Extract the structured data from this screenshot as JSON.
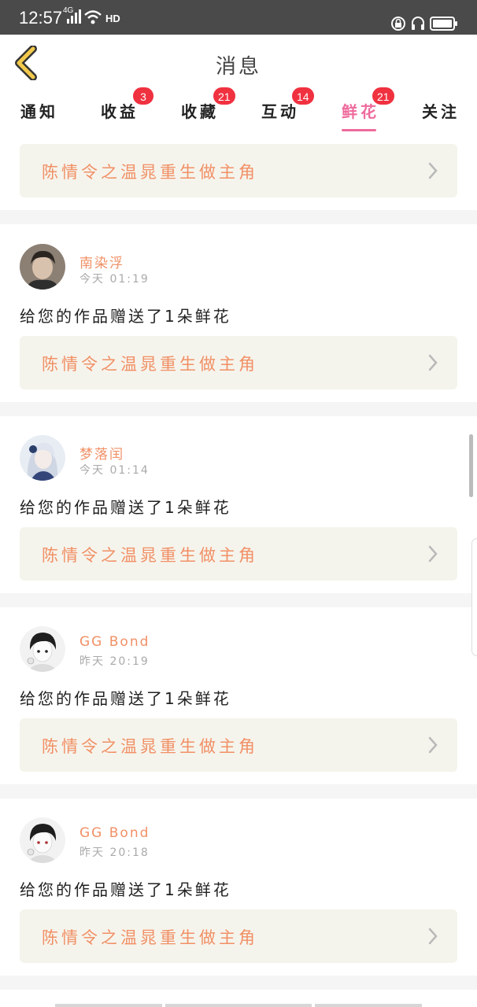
{
  "status_bar": {
    "time": "12:57",
    "network": "4G",
    "hd": "HD"
  },
  "header": {
    "title": "消息",
    "back_icon": "chevron-left-icon"
  },
  "tabs": [
    {
      "label": "通知",
      "badge": ""
    },
    {
      "label": "收益",
      "badge": "3"
    },
    {
      "label": "收藏",
      "badge": "21"
    },
    {
      "label": "互动",
      "badge": "14"
    },
    {
      "label": "鲜花",
      "badge": "21"
    },
    {
      "label": "关注",
      "badge": ""
    }
  ],
  "active_tab": "鲜花",
  "top_book": "陈情令之温晁重生做主角",
  "messages": [
    {
      "user": "南染浮",
      "time": "今天 01:19",
      "text": "给您的作品赠送了1朵鲜花",
      "book": "陈情令之温晁重生做主角"
    },
    {
      "user": "梦落闰",
      "time": "今天 01:14",
      "text": "给您的作品赠送了1朵鲜花",
      "book": "陈情令之温晁重生做主角"
    },
    {
      "user": "GG Bond",
      "time": "昨天 20:19",
      "text": "给您的作品赠送了1朵鲜花",
      "book": "陈情令之温晁重生做主角"
    },
    {
      "user": "GG Bond",
      "time": "昨天 20:18",
      "text": "给您的作品赠送了1朵鲜花",
      "book": "陈情令之温晁重生做主角"
    }
  ],
  "colors": {
    "accent_pink": "#ee6b9c",
    "book_orange": "#f19066",
    "badge_red": "#f0313f",
    "card_bg": "#f5f4ec"
  }
}
